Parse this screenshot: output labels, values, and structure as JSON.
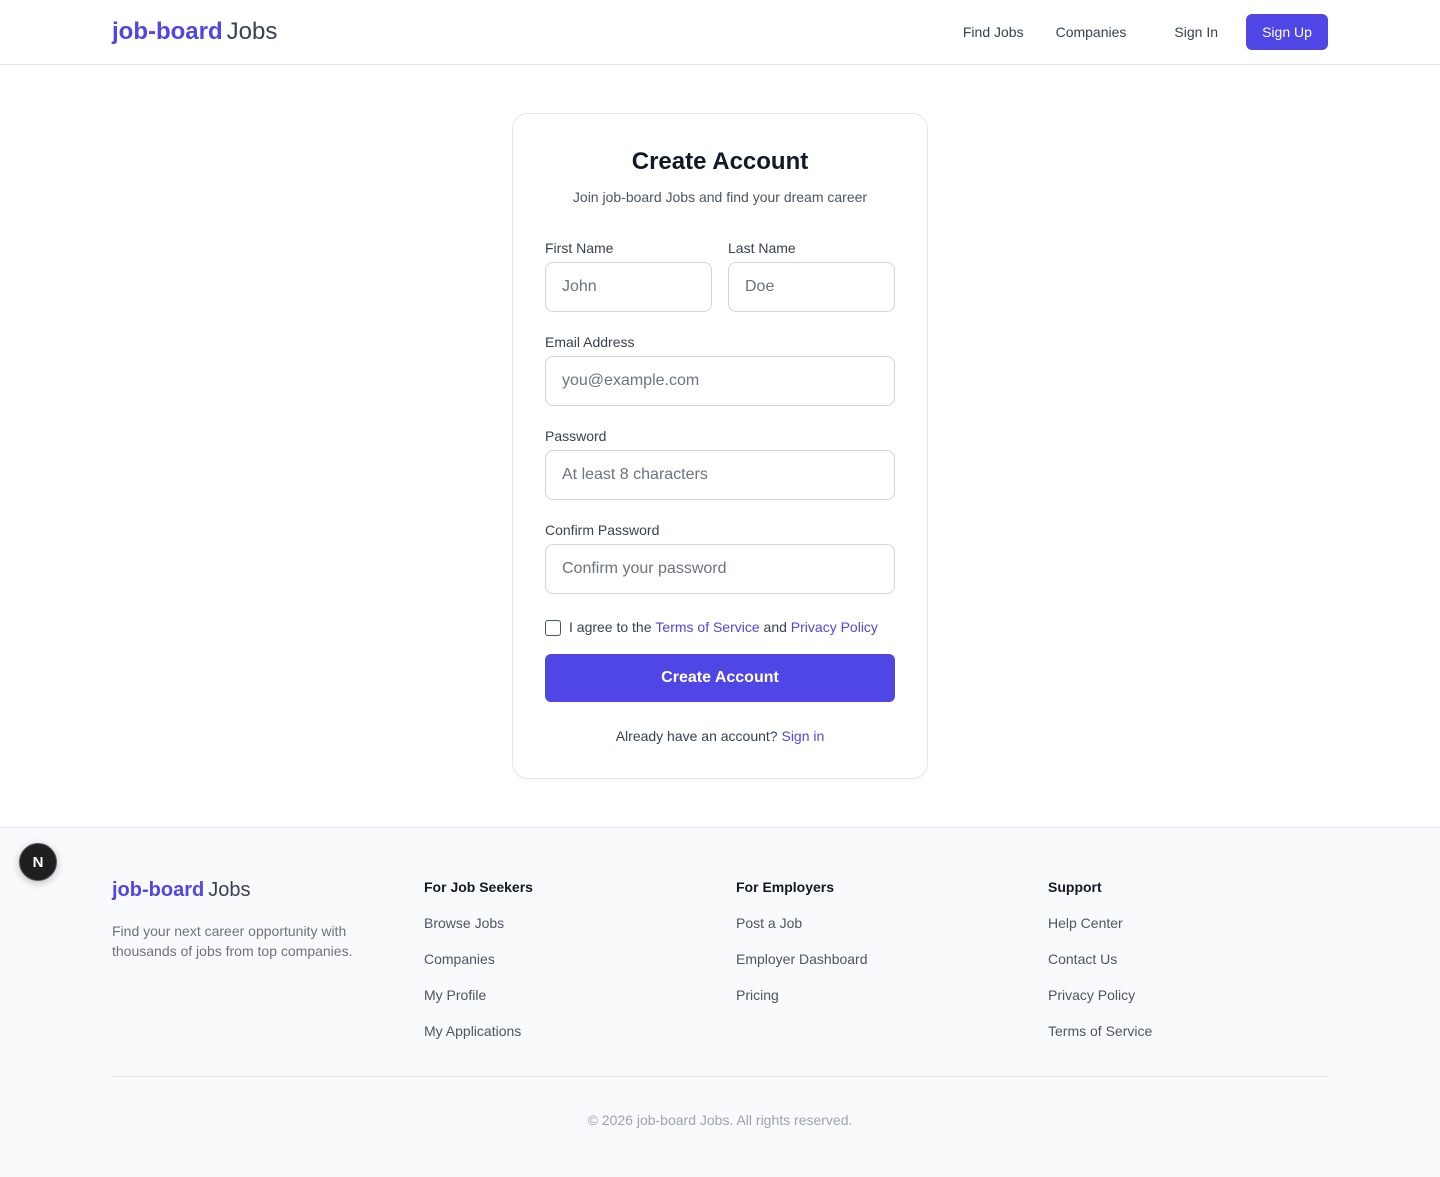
{
  "header": {
    "logo_brand": "job-board",
    "logo_suffix": "Jobs",
    "nav": {
      "find_jobs": "Find Jobs",
      "companies": "Companies",
      "sign_in": "Sign In",
      "sign_up": "Sign Up"
    }
  },
  "form": {
    "title": "Create Account",
    "subtitle": "Join job-board Jobs and find your dream career",
    "first_name": {
      "label": "First Name",
      "placeholder": "John"
    },
    "last_name": {
      "label": "Last Name",
      "placeholder": "Doe"
    },
    "email": {
      "label": "Email Address",
      "placeholder": "you@example.com"
    },
    "password": {
      "label": "Password",
      "placeholder": "At least 8 characters"
    },
    "confirm_password": {
      "label": "Confirm Password",
      "placeholder": "Confirm your password"
    },
    "terms": {
      "prefix": "I agree to the",
      "tos": "Terms of Service",
      "and": "and",
      "privacy": "Privacy Policy"
    },
    "submit": "Create Account",
    "signin_prompt": "Already have an account?",
    "signin_link": "Sign in"
  },
  "footer": {
    "logo_brand": "job-board",
    "logo_suffix": "Jobs",
    "description": "Find your next career opportunity with thousands of jobs from top companies.",
    "columns": [
      {
        "title": "For Job Seekers",
        "links": [
          "Browse Jobs",
          "Companies",
          "My Profile",
          "My Applications"
        ]
      },
      {
        "title": "For Employers",
        "links": [
          "Post a Job",
          "Employer Dashboard",
          "Pricing"
        ]
      },
      {
        "title": "Support",
        "links": [
          "Help Center",
          "Contact Us",
          "Privacy Policy",
          "Terms of Service"
        ]
      }
    ],
    "copyright": "© 2026 job-board Jobs. All rights reserved."
  },
  "badge": {
    "label": "N"
  },
  "colors": {
    "accent": "#4f46e5",
    "border": "#e5e7eb",
    "footer_bg": "#f9fafb"
  }
}
